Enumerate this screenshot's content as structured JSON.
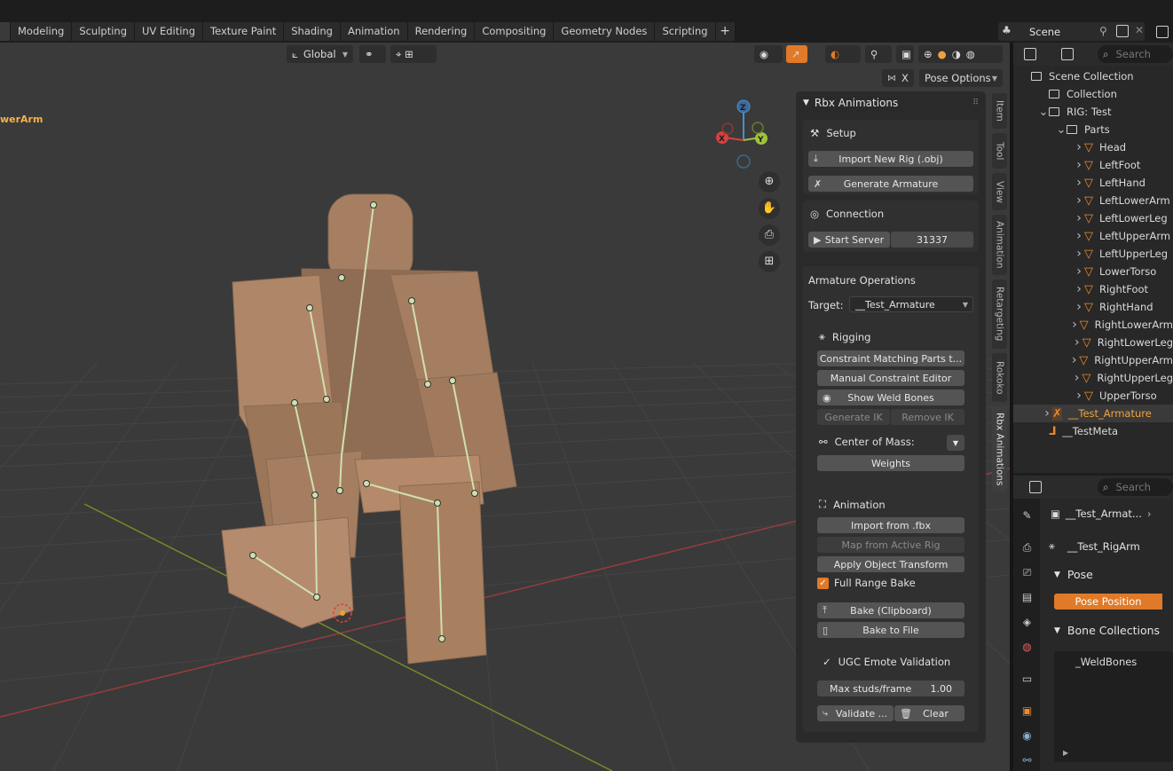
{
  "workspace_tabs": [
    "Modeling",
    "Sculpting",
    "UV Editing",
    "Texture Paint",
    "Shading",
    "Animation",
    "Rendering",
    "Compositing",
    "Geometry Nodes",
    "Scripting",
    "+"
  ],
  "scene_name": "Scene",
  "viewport": {
    "orientation": "Global",
    "active_bone_label": "werArm",
    "pose_options": "Pose Options",
    "x_toggle": "X",
    "gizmo": {
      "x": "X",
      "y": "Y",
      "z": "Z"
    },
    "nav_icons": [
      "zoom-icon",
      "hand-pan-icon",
      "camera-icon",
      "grid-view-icon"
    ]
  },
  "npanel": {
    "title": "Rbx Animations",
    "setup": {
      "label": "Setup",
      "import_rig": "Import New Rig (.obj)",
      "generate_armature": "Generate Armature"
    },
    "connection": {
      "label": "Connection",
      "start_server": "Start Server",
      "port": "31337"
    },
    "armature_ops": {
      "label": "Armature Operations",
      "target_label": "Target:",
      "target_value": "__Test_Armature",
      "rigging": "Rigging",
      "constraint_matching": "Constraint Matching Parts t...",
      "manual_constraint": "Manual Constraint Editor",
      "show_weld": "Show Weld Bones",
      "generate_ik": "Generate IK",
      "remove_ik": "Remove IK",
      "center_of_mass": "Center of Mass:",
      "weights": "Weights",
      "animation": "Animation",
      "import_fbx": "Import from .fbx",
      "map_active": "Map from Active Rig",
      "apply_transform": "Apply Object Transform",
      "full_range_bake": "Full Range Bake",
      "full_range_checked": true,
      "bake_clipboard": "Bake (Clipboard)",
      "bake_file": "Bake to File",
      "ugc_validation": "UGC Emote Validation",
      "max_studs_label": "Max studs/frame",
      "max_studs_value": "1.00",
      "validate": "Validate ...",
      "clear": "Clear"
    }
  },
  "side_tabs": [
    "Item",
    "Tool",
    "View",
    "Animation",
    "Retargeting",
    "Rokoko",
    "Rbx Animations"
  ],
  "outliner": {
    "search_placeholder": "Search",
    "rows": [
      {
        "label": "Scene Collection",
        "indent": 0,
        "kind": "collection"
      },
      {
        "label": "Collection",
        "indent": 1,
        "kind": "collection"
      },
      {
        "label": "RIG: Test",
        "indent": 1,
        "kind": "collection"
      },
      {
        "label": "Parts",
        "indent": 2,
        "kind": "collection"
      },
      {
        "label": "Head",
        "indent": 3,
        "kind": "mesh"
      },
      {
        "label": "LeftFoot",
        "indent": 3,
        "kind": "mesh"
      },
      {
        "label": "LeftHand",
        "indent": 3,
        "kind": "mesh"
      },
      {
        "label": "LeftLowerArm",
        "indent": 3,
        "kind": "mesh"
      },
      {
        "label": "LeftLowerLeg",
        "indent": 3,
        "kind": "mesh"
      },
      {
        "label": "LeftUpperArm",
        "indent": 3,
        "kind": "mesh"
      },
      {
        "label": "LeftUpperLeg",
        "indent": 3,
        "kind": "mesh"
      },
      {
        "label": "LowerTorso",
        "indent": 3,
        "kind": "mesh"
      },
      {
        "label": "RightFoot",
        "indent": 3,
        "kind": "mesh"
      },
      {
        "label": "RightHand",
        "indent": 3,
        "kind": "mesh"
      },
      {
        "label": "RightLowerArm",
        "indent": 3,
        "kind": "mesh"
      },
      {
        "label": "RightLowerLeg",
        "indent": 3,
        "kind": "mesh"
      },
      {
        "label": "RightUpperArm",
        "indent": 3,
        "kind": "mesh"
      },
      {
        "label": "RightUpperLeg",
        "indent": 3,
        "kind": "mesh"
      },
      {
        "label": "UpperTorso",
        "indent": 3,
        "kind": "mesh"
      },
      {
        "label": "__Test_Armature",
        "indent": 1,
        "kind": "armature",
        "selected": true
      },
      {
        "label": "__TestMeta",
        "indent": 1,
        "kind": "meta"
      }
    ]
  },
  "properties": {
    "search_placeholder": "Search",
    "object_name": "__Test_Armat...",
    "armature_data": "__Test_RigArm",
    "pose_section": "Pose",
    "pose_position": "Pose Position",
    "bone_collections_section": "Bone Collections",
    "bone_collection_item": "_WeldBones"
  },
  "colors": {
    "accent": "#e07a28",
    "selected_text": "#f3a33a",
    "viewport_bg": "#3a3a3a",
    "mesh": "#a67f63"
  }
}
